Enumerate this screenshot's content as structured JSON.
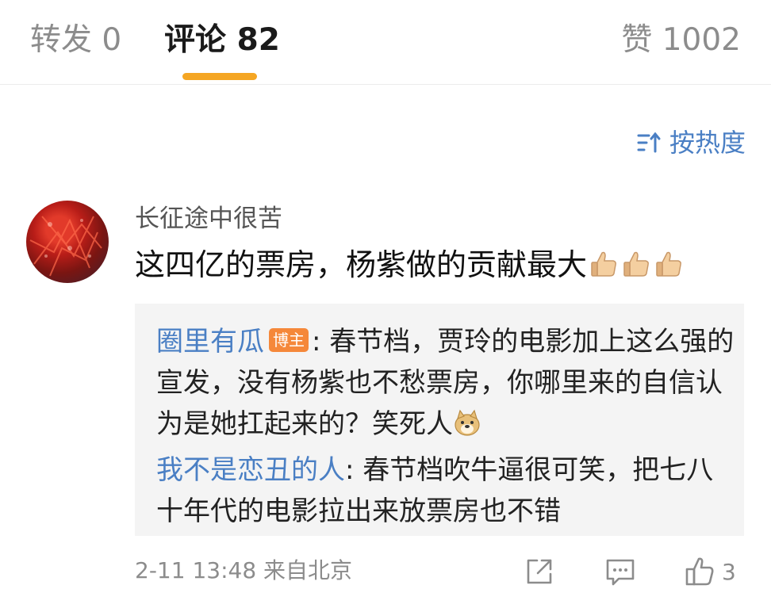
{
  "tabs": {
    "repost": "转发 0",
    "comments": "评论 82",
    "likes": "赞 1002"
  },
  "sort": {
    "label": "按热度"
  },
  "comment": {
    "username": "长征途中很苦",
    "text": "这四亿的票房，杨紫做的贡献最大",
    "meta": "2-11 13:48 来自北京",
    "like_count": "3"
  },
  "replies": [
    {
      "user": "圈里有瓜",
      "badge": "博主",
      "text": ": 春节档，贾玲的电影加上这么强的宣发，没有杨紫也不愁票房，你哪里来的自信认为是她扛起来的？笑死人"
    },
    {
      "user": "我不是恋丑的人",
      "text": ": 春节档吹牛逼很可笑，把七八十年代的电影拉出来放票房也不错"
    }
  ],
  "colors": {
    "accent_orange": "#f5a623",
    "link_blue": "#4a7fc4",
    "badge_orange": "#f5883a",
    "muted_gray": "#8c8c8c"
  },
  "icons": [
    "sort-icon",
    "thumbs-up-emoji",
    "doge-emoji",
    "share-icon",
    "comment-icon",
    "like-icon"
  ]
}
